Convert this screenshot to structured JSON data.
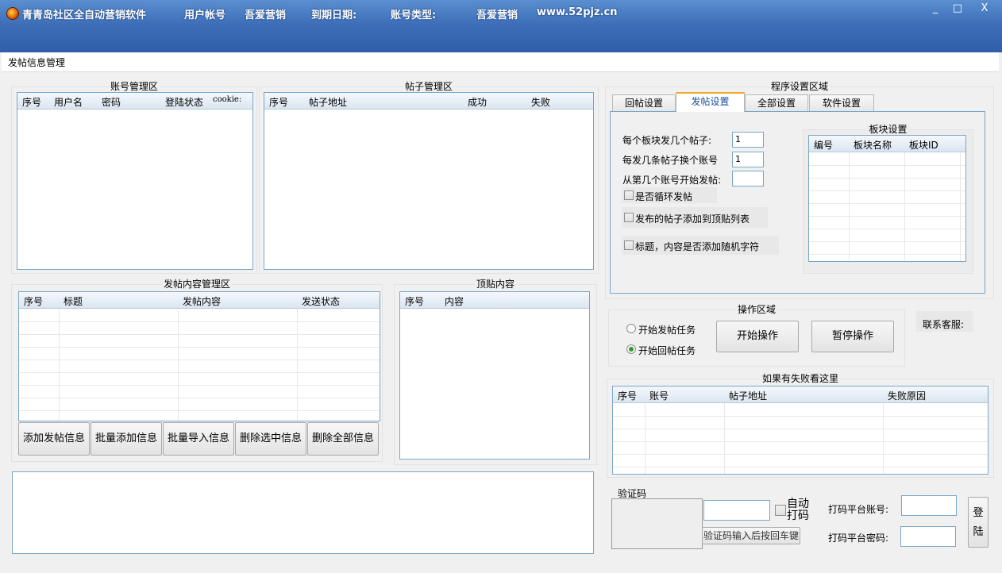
{
  "titlebar": {
    "app_title": "青青岛社区全自动营销软件",
    "user_account_label": "用户帐号",
    "user_account_value": "吾爱营销",
    "expiry_label": "到期日期:",
    "account_type_label": "账号类型:",
    "account_type_value": "吾爱营销",
    "website": "www.52pjz.cn",
    "minimize": "_",
    "maximize": "□",
    "close": "X"
  },
  "menubar": {
    "label": "发帖信息管理"
  },
  "account_panel": {
    "title": "账号管理区",
    "columns": [
      "序号",
      "用户名",
      "密码",
      "登陆状态",
      "cookie:"
    ]
  },
  "post_panel": {
    "title": "帖子管理区",
    "columns": [
      "序号",
      "帖子地址",
      "成功",
      "失败"
    ]
  },
  "settings_panel": {
    "title": "程序设置区域",
    "tabs": [
      "回帖设置",
      "发帖设置",
      "全部设置",
      "软件设置"
    ],
    "active_tab": "发帖设置",
    "posts_per_board_label": "每个板块发几个帖子:",
    "posts_per_board_value": "1",
    "switch_account_label": "每发几条帖子换个账号",
    "switch_account_value": "1",
    "start_account_label": "从第几个账号开始发帖:",
    "start_account_value": "",
    "loop_label": "是否循环发帖",
    "add_top_label": "发布的帖子添加到顶贴列表",
    "random_chars_label": "标题，内容是否添加随机字符",
    "board_settings": {
      "title": "板块设置",
      "columns": [
        "编号",
        "板块名称",
        "板块ID"
      ]
    }
  },
  "content_panel": {
    "title": "发帖内容管理区",
    "columns": [
      "序号",
      "标题",
      "发帖内容",
      "发送状态"
    ],
    "buttons": [
      "添加发帖信息",
      "批量添加信息",
      "批量导入信息",
      "删除选中信息",
      "删除全部信息"
    ]
  },
  "top_panel": {
    "title": "顶贴内容",
    "columns": [
      "序号",
      "内容"
    ]
  },
  "operation_panel": {
    "title": "操作区域",
    "radio_post": "开始发帖任务",
    "radio_reply": "开始回帖任务",
    "selected": "开始回帖任务",
    "start_button": "开始操作",
    "pause_button": "暂停操作",
    "contact_label": "联系客服:"
  },
  "failure_panel": {
    "title": "如果有失败看这里",
    "columns": [
      "序号",
      "账号",
      "帖子地址",
      "失败原因"
    ]
  },
  "captcha_panel": {
    "title": "验证码",
    "hint_button": "验证码输入后按回车键",
    "auto_label": "自动打码",
    "platform_account_label": "打码平台账号:",
    "platform_password_label": "打码平台密码:",
    "login_button": "登陆"
  }
}
